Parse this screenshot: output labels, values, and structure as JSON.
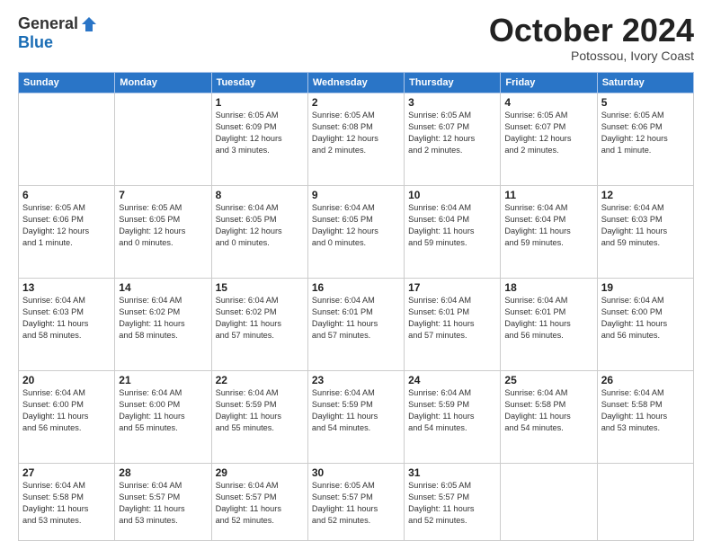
{
  "header": {
    "logo_general": "General",
    "logo_blue": "Blue",
    "month_title": "October 2024",
    "location": "Potossou, Ivory Coast"
  },
  "calendar": {
    "days_of_week": [
      "Sunday",
      "Monday",
      "Tuesday",
      "Wednesday",
      "Thursday",
      "Friday",
      "Saturday"
    ],
    "weeks": [
      [
        {
          "day": "",
          "info": ""
        },
        {
          "day": "",
          "info": ""
        },
        {
          "day": "1",
          "info": "Sunrise: 6:05 AM\nSunset: 6:09 PM\nDaylight: 12 hours\nand 3 minutes."
        },
        {
          "day": "2",
          "info": "Sunrise: 6:05 AM\nSunset: 6:08 PM\nDaylight: 12 hours\nand 2 minutes."
        },
        {
          "day": "3",
          "info": "Sunrise: 6:05 AM\nSunset: 6:07 PM\nDaylight: 12 hours\nand 2 minutes."
        },
        {
          "day": "4",
          "info": "Sunrise: 6:05 AM\nSunset: 6:07 PM\nDaylight: 12 hours\nand 2 minutes."
        },
        {
          "day": "5",
          "info": "Sunrise: 6:05 AM\nSunset: 6:06 PM\nDaylight: 12 hours\nand 1 minute."
        }
      ],
      [
        {
          "day": "6",
          "info": "Sunrise: 6:05 AM\nSunset: 6:06 PM\nDaylight: 12 hours\nand 1 minute."
        },
        {
          "day": "7",
          "info": "Sunrise: 6:05 AM\nSunset: 6:05 PM\nDaylight: 12 hours\nand 0 minutes."
        },
        {
          "day": "8",
          "info": "Sunrise: 6:04 AM\nSunset: 6:05 PM\nDaylight: 12 hours\nand 0 minutes."
        },
        {
          "day": "9",
          "info": "Sunrise: 6:04 AM\nSunset: 6:05 PM\nDaylight: 12 hours\nand 0 minutes."
        },
        {
          "day": "10",
          "info": "Sunrise: 6:04 AM\nSunset: 6:04 PM\nDaylight: 11 hours\nand 59 minutes."
        },
        {
          "day": "11",
          "info": "Sunrise: 6:04 AM\nSunset: 6:04 PM\nDaylight: 11 hours\nand 59 minutes."
        },
        {
          "day": "12",
          "info": "Sunrise: 6:04 AM\nSunset: 6:03 PM\nDaylight: 11 hours\nand 59 minutes."
        }
      ],
      [
        {
          "day": "13",
          "info": "Sunrise: 6:04 AM\nSunset: 6:03 PM\nDaylight: 11 hours\nand 58 minutes."
        },
        {
          "day": "14",
          "info": "Sunrise: 6:04 AM\nSunset: 6:02 PM\nDaylight: 11 hours\nand 58 minutes."
        },
        {
          "day": "15",
          "info": "Sunrise: 6:04 AM\nSunset: 6:02 PM\nDaylight: 11 hours\nand 57 minutes."
        },
        {
          "day": "16",
          "info": "Sunrise: 6:04 AM\nSunset: 6:01 PM\nDaylight: 11 hours\nand 57 minutes."
        },
        {
          "day": "17",
          "info": "Sunrise: 6:04 AM\nSunset: 6:01 PM\nDaylight: 11 hours\nand 57 minutes."
        },
        {
          "day": "18",
          "info": "Sunrise: 6:04 AM\nSunset: 6:01 PM\nDaylight: 11 hours\nand 56 minutes."
        },
        {
          "day": "19",
          "info": "Sunrise: 6:04 AM\nSunset: 6:00 PM\nDaylight: 11 hours\nand 56 minutes."
        }
      ],
      [
        {
          "day": "20",
          "info": "Sunrise: 6:04 AM\nSunset: 6:00 PM\nDaylight: 11 hours\nand 56 minutes."
        },
        {
          "day": "21",
          "info": "Sunrise: 6:04 AM\nSunset: 6:00 PM\nDaylight: 11 hours\nand 55 minutes."
        },
        {
          "day": "22",
          "info": "Sunrise: 6:04 AM\nSunset: 5:59 PM\nDaylight: 11 hours\nand 55 minutes."
        },
        {
          "day": "23",
          "info": "Sunrise: 6:04 AM\nSunset: 5:59 PM\nDaylight: 11 hours\nand 54 minutes."
        },
        {
          "day": "24",
          "info": "Sunrise: 6:04 AM\nSunset: 5:59 PM\nDaylight: 11 hours\nand 54 minutes."
        },
        {
          "day": "25",
          "info": "Sunrise: 6:04 AM\nSunset: 5:58 PM\nDaylight: 11 hours\nand 54 minutes."
        },
        {
          "day": "26",
          "info": "Sunrise: 6:04 AM\nSunset: 5:58 PM\nDaylight: 11 hours\nand 53 minutes."
        }
      ],
      [
        {
          "day": "27",
          "info": "Sunrise: 6:04 AM\nSunset: 5:58 PM\nDaylight: 11 hours\nand 53 minutes."
        },
        {
          "day": "28",
          "info": "Sunrise: 6:04 AM\nSunset: 5:57 PM\nDaylight: 11 hours\nand 53 minutes."
        },
        {
          "day": "29",
          "info": "Sunrise: 6:04 AM\nSunset: 5:57 PM\nDaylight: 11 hours\nand 52 minutes."
        },
        {
          "day": "30",
          "info": "Sunrise: 6:05 AM\nSunset: 5:57 PM\nDaylight: 11 hours\nand 52 minutes."
        },
        {
          "day": "31",
          "info": "Sunrise: 6:05 AM\nSunset: 5:57 PM\nDaylight: 11 hours\nand 52 minutes."
        },
        {
          "day": "",
          "info": ""
        },
        {
          "day": "",
          "info": ""
        }
      ]
    ]
  }
}
